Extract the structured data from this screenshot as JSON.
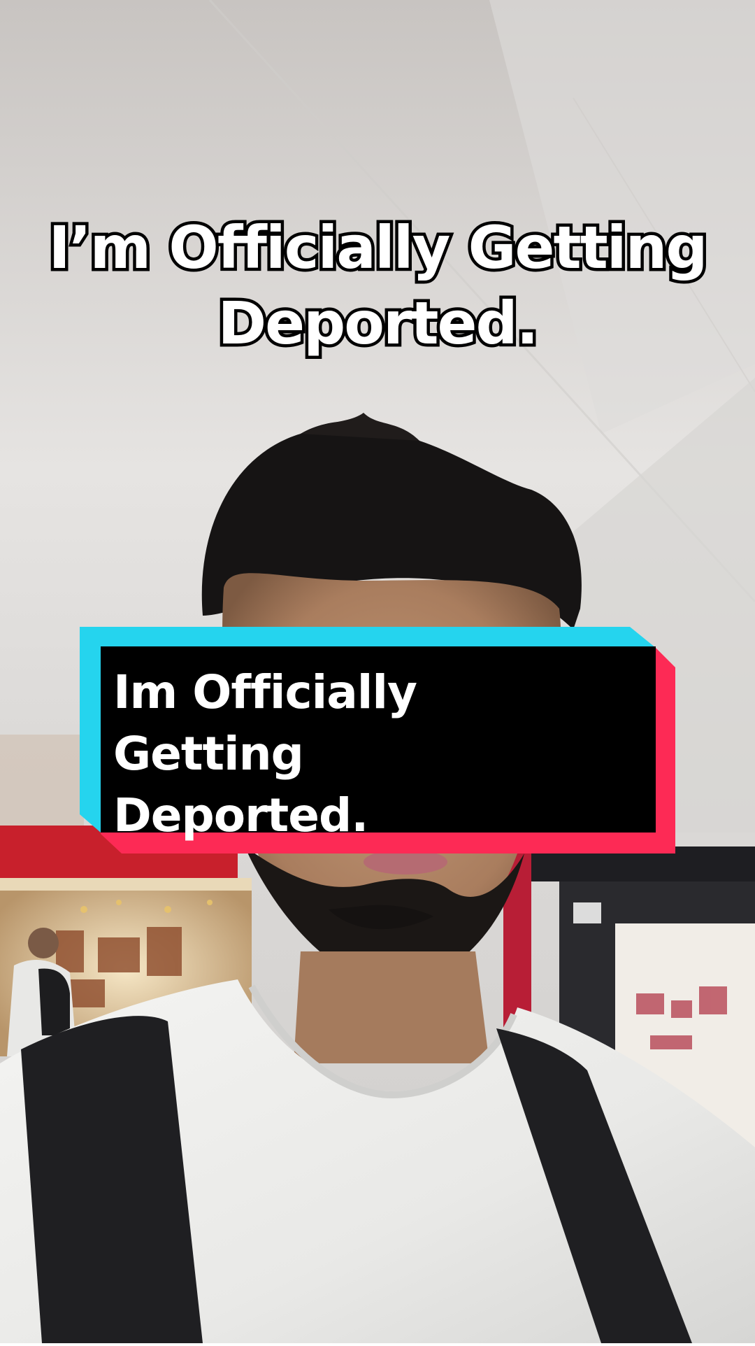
{
  "top_caption": {
    "line1": "I’m Officially Getting",
    "line2": "Deported."
  },
  "overlay_card": {
    "line1": "Im Officially Getting",
    "line2": "Deported."
  },
  "colors": {
    "card_accent_cyan": "#25d4ee",
    "card_accent_red": "#fd2a55",
    "card_background": "#000000",
    "text": "#ffffff"
  }
}
